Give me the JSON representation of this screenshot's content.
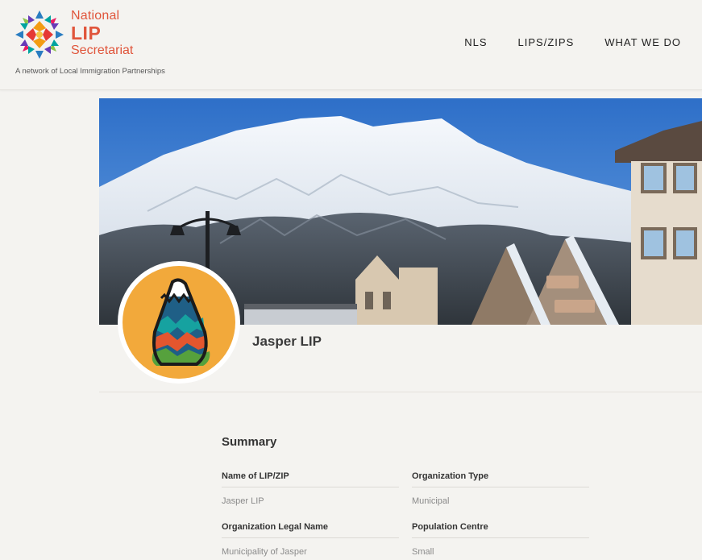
{
  "brand": {
    "line1": "National",
    "line2": "LIP",
    "line3": "Secretariat",
    "tagline": "A network of Local Immigration Partnerships",
    "accent_color": "#e0553b"
  },
  "nav": {
    "items": [
      {
        "label": "NLS"
      },
      {
        "label": "LIPS/ZIPS"
      },
      {
        "label": "WHAT WE DO"
      }
    ]
  },
  "banner": {
    "icon": "mountain-town-photo"
  },
  "profile": {
    "name": "Jasper LIP",
    "avatar_icon": "mountain-logo-icon"
  },
  "summary": {
    "heading": "Summary",
    "fields": [
      {
        "label": "Name of LIP/ZIP",
        "value": "Jasper LIP"
      },
      {
        "label": "Organization Type",
        "value": "Municipal"
      },
      {
        "label": "Organization Legal Name",
        "value": "Municipality of Jasper"
      },
      {
        "label": "Population Centre",
        "value": "Small"
      }
    ]
  }
}
